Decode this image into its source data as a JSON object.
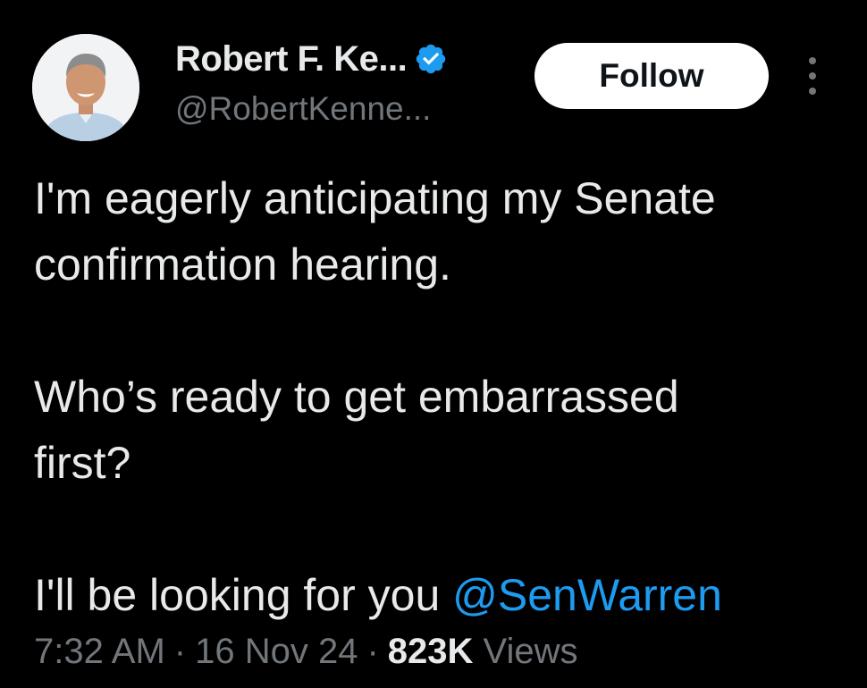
{
  "author": {
    "display_name": "Robert F. Ke...",
    "handle": "@RobertKenne...",
    "verified_icon": "verified-badge-icon"
  },
  "actions": {
    "follow_label": "Follow",
    "more_icon": "more-options-icon"
  },
  "tweet": {
    "line1": "I'm eagerly anticipating my Senate",
    "line2": "confirmation hearing.",
    "line3": "Who’s ready to get embarrassed",
    "line4": "first?",
    "line5_text": "I'll be looking for you ",
    "mention": "@SenWarren"
  },
  "meta": {
    "time": "7:32 AM",
    "date": "16 Nov 24",
    "separator": "·",
    "views_count": "823K",
    "views_label": " Views"
  },
  "colors": {
    "background": "#000000",
    "text": "#e7e9ea",
    "muted": "#71767b",
    "link": "#1d9bf0",
    "verified": "#1d9bf0"
  }
}
